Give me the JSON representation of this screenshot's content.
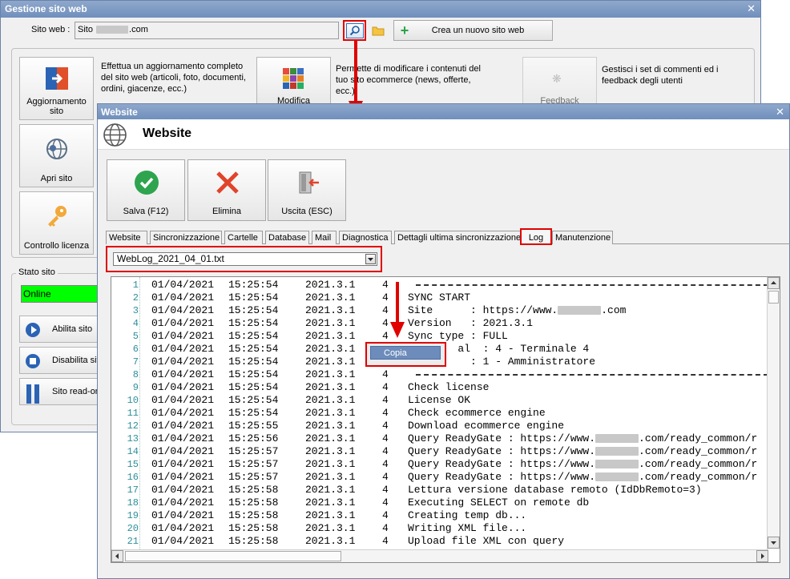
{
  "back_window": {
    "title": "Gestione sito web",
    "site_label": "Sito web :",
    "site_value_prefix": "Sito",
    "site_value_suffix": ".com",
    "new_site_button": "Crea un nuovo sito web",
    "tiles": {
      "update": "Aggiornamento sito",
      "open": "Apri sito",
      "license": "Controllo licenza",
      "edit": "Modifica",
      "feedback": "Feedback"
    },
    "descriptions": {
      "update": "Effettua un aggiornamento completo del sito web (articoli, foto, documenti, ordini, giacenze, ecc.)",
      "edit": "Permette di modificare i contenuti del tuo sito ecommerce (news, offerte, ecc.)",
      "feedback": "Gestisci i set di commenti ed i feedback degli utenti"
    },
    "status_title": "Stato sito",
    "status_value": "Online",
    "side_buttons": {
      "enable": "Abilita sito",
      "disable": "Disabilita sito",
      "readonly": "Sito read-only"
    }
  },
  "front_window": {
    "title": "Website",
    "header_title": "Website",
    "toolbar": {
      "save": "Salva (F12)",
      "delete": "Elimina",
      "exit": "Uscita (ESC)"
    },
    "tabs": [
      "Website",
      "Sincronizzazione",
      "Cartelle",
      "Database",
      "Mail",
      "Diagnostica",
      "Dettagli ultima sincronizzazione",
      "Log",
      "Manutenzione"
    ],
    "active_tab": "Log",
    "log_file": "WebLog_2021_04_01.txt",
    "context_menu_item": "Copia",
    "log_rows": [
      {
        "n": "1",
        "date": "01/04/2021",
        "time": "15:25:54",
        "ver": "2021.3.1",
        "lvl": "4",
        "msg": "",
        "dash": true
      },
      {
        "n": "2",
        "date": "01/04/2021",
        "time": "15:25:54",
        "ver": "2021.3.1",
        "lvl": "4",
        "msg": "SYNC START"
      },
      {
        "n": "3",
        "date": "01/04/2021",
        "time": "15:25:54",
        "ver": "2021.3.1",
        "lvl": "4",
        "msg": "Site      : https://www.",
        "blur": true,
        "msg_tail": ".com"
      },
      {
        "n": "4",
        "date": "01/04/2021",
        "time": "15:25:54",
        "ver": "2021.3.1",
        "lvl": "4",
        "msg": "Version   : 2021.3.1"
      },
      {
        "n": "5",
        "date": "01/04/2021",
        "time": "15:25:54",
        "ver": "2021.3.1",
        "lvl": "4",
        "msg": "Sync type : FULL"
      },
      {
        "n": "6",
        "date": "01/04/2021",
        "time": "15:25:54",
        "ver": "2021.3.1",
        "lvl": "",
        "msg": "        al  : 4 - Terminale 4"
      },
      {
        "n": "7",
        "date": "01/04/2021",
        "time": "15:25:54",
        "ver": "2021.3.1",
        "lvl": "",
        "msg": "          : 1 - Amministratore"
      },
      {
        "n": "8",
        "date": "01/04/2021",
        "time": "15:25:54",
        "ver": "2021.3.1",
        "lvl": "4",
        "msg": "",
        "dash": true
      },
      {
        "n": "9",
        "date": "01/04/2021",
        "time": "15:25:54",
        "ver": "2021.3.1",
        "lvl": "4",
        "msg": "Check license"
      },
      {
        "n": "10",
        "date": "01/04/2021",
        "time": "15:25:54",
        "ver": "2021.3.1",
        "lvl": "4",
        "msg": "License OK"
      },
      {
        "n": "11",
        "date": "01/04/2021",
        "time": "15:25:54",
        "ver": "2021.3.1",
        "lvl": "4",
        "msg": "Check ecommerce engine"
      },
      {
        "n": "12",
        "date": "01/04/2021",
        "time": "15:25:55",
        "ver": "2021.3.1",
        "lvl": "4",
        "msg": "Download ecommerce engine"
      },
      {
        "n": "13",
        "date": "01/04/2021",
        "time": "15:25:56",
        "ver": "2021.3.1",
        "lvl": "4",
        "msg": "Query ReadyGate : https://www.",
        "blur": true,
        "msg_tail": ".com/ready_common/r"
      },
      {
        "n": "14",
        "date": "01/04/2021",
        "time": "15:25:57",
        "ver": "2021.3.1",
        "lvl": "4",
        "msg": "Query ReadyGate : https://www.",
        "blur": true,
        "msg_tail": ".com/ready_common/r"
      },
      {
        "n": "15",
        "date": "01/04/2021",
        "time": "15:25:57",
        "ver": "2021.3.1",
        "lvl": "4",
        "msg": "Query ReadyGate : https://www.",
        "blur": true,
        "msg_tail": ".com/ready_common/r"
      },
      {
        "n": "16",
        "date": "01/04/2021",
        "time": "15:25:57",
        "ver": "2021.3.1",
        "lvl": "4",
        "msg": "Query ReadyGate : https://www.",
        "blur": true,
        "msg_tail": ".com/ready_common/r"
      },
      {
        "n": "17",
        "date": "01/04/2021",
        "time": "15:25:58",
        "ver": "2021.3.1",
        "lvl": "4",
        "msg": "Lettura versione database remoto (IdDbRemoto=3)"
      },
      {
        "n": "18",
        "date": "01/04/2021",
        "time": "15:25:58",
        "ver": "2021.3.1",
        "lvl": "4",
        "msg": "Executing SELECT on remote db"
      },
      {
        "n": "19",
        "date": "01/04/2021",
        "time": "15:25:58",
        "ver": "2021.3.1",
        "lvl": "4",
        "msg": "Creating temp db..."
      },
      {
        "n": "20",
        "date": "01/04/2021",
        "time": "15:25:58",
        "ver": "2021.3.1",
        "lvl": "4",
        "msg": "Writing XML file..."
      },
      {
        "n": "21",
        "date": "01/04/2021",
        "time": "15:25:58",
        "ver": "2021.3.1",
        "lvl": "4",
        "msg": "Upload file XML con query"
      }
    ]
  },
  "colors": {
    "highlight": "#e00000",
    "online": "#00ff00",
    "titlebar": "#7b98c4",
    "line_numbers": "#2f8f9b"
  }
}
